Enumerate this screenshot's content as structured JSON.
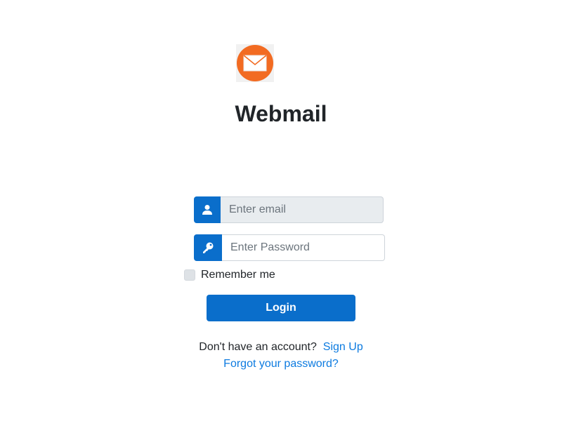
{
  "app": {
    "title": "Webmail",
    "logo_icon": "envelope-icon"
  },
  "login_form": {
    "email": {
      "icon": "user-icon",
      "placeholder": "Enter email",
      "value": ""
    },
    "password": {
      "icon": "key-icon",
      "placeholder": "Enter Password",
      "value": ""
    },
    "remember_me": {
      "label": "Remember me",
      "checked": false
    },
    "login_label": "Login"
  },
  "footer": {
    "signup_prompt": "Don't have an account?",
    "signup_link": "Sign Up",
    "forgot_link": "Forgot your password?"
  },
  "colors": {
    "primary": "#0d6efd",
    "button": "#0a6ecb",
    "link": "#0d7be0",
    "logo_orange": "#f26b22",
    "input_bg_filled": "#e8ecef"
  }
}
